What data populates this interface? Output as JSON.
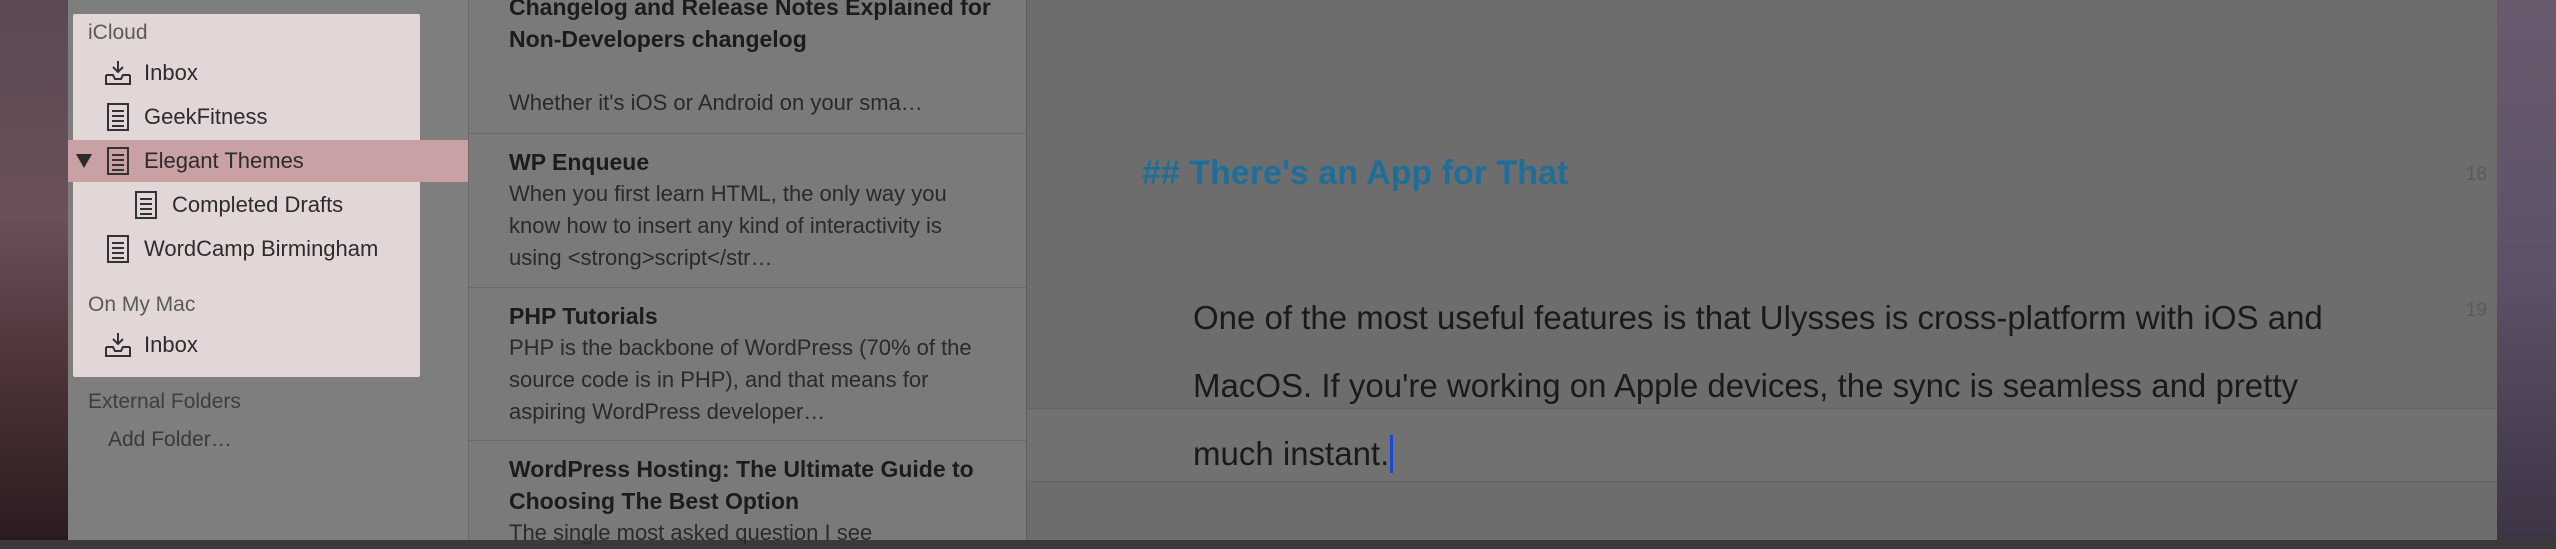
{
  "sidebar": {
    "icloud_header": "iCloud",
    "icloud_items": [
      {
        "label": "Inbox",
        "icon": "inbox-icon"
      },
      {
        "label": "GeekFitness",
        "icon": "document-icon"
      },
      {
        "label": "Elegant Themes",
        "icon": "document-icon",
        "expanded": true,
        "selected": true
      },
      {
        "label": "Completed Drafts",
        "icon": "document-icon"
      },
      {
        "label": "WordCamp Birmingham",
        "icon": "document-icon"
      }
    ],
    "mac_header": "On My Mac",
    "mac_items": [
      {
        "label": "Inbox",
        "icon": "inbox-icon"
      }
    ],
    "external_header": "External Folders",
    "add_folder": "Add Folder…"
  },
  "sheets": [
    {
      "title": "Changelog and Release Notes Explained for Non-Developers changelog",
      "excerpt": "Whether it's iOS or Android on your sma…"
    },
    {
      "title": "WP Enqueue",
      "excerpt": "When you first learn HTML, the only way you know how to insert any kind of interactivity is using <strong>script</str…"
    },
    {
      "title": "PHP Tutorials",
      "excerpt": "PHP is the backbone of WordPress (70% of the source code is in PHP), and that means for aspiring WordPress developer…"
    },
    {
      "title": "WordPress Hosting: The Ultimate Guide to Choosing The Best Option",
      "excerpt": "The single most asked question I see"
    }
  ],
  "editor": {
    "heading": "## There's an App for That",
    "heading_line": "18",
    "paragraph": "One of the most useful features is that Ulysses is cross-platform with iOS and MacOS. If you're working on Apple devices, the sync is seamless and pretty much instant.",
    "paragraph_line": "19"
  },
  "colors": {
    "heading": "#1d6f9a",
    "caret": "#1a47d8",
    "sidebar_highlight": "#e3d6d7",
    "selected_row": "#c9a1a5"
  }
}
